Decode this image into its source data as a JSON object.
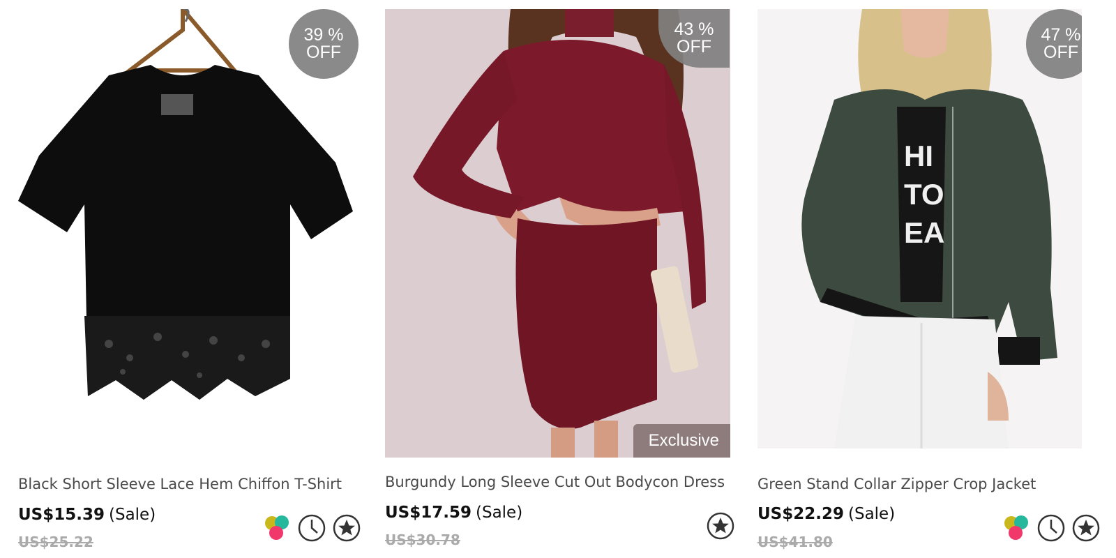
{
  "products": [
    {
      "discount_percent": "39 %",
      "discount_off": "OFF",
      "name": "Black Short Sleeve Lace Hem Chiffon T-Shirt",
      "price": "US$15.39",
      "sale_label": "(Sale)",
      "original_price": "US$25.22",
      "icons": [
        "colors-icon",
        "clock-icon",
        "star-icon"
      ]
    },
    {
      "discount_percent": "43 %",
      "discount_off": "OFF",
      "tag": "Exclusive",
      "name": "Burgundy Long Sleeve Cut Out Bodycon Dress",
      "price": "US$17.59",
      "sale_label": "(Sale)",
      "original_price": "US$30.78",
      "icons": [
        "star-icon"
      ]
    },
    {
      "discount_percent": "47 %",
      "discount_off": "OFF",
      "name": "Green Stand Collar Zipper Crop Jacket",
      "price": "US$22.29",
      "sale_label": "(Sale)",
      "original_price": "US$41.80",
      "icons": [
        "colors-icon",
        "clock-icon",
        "star-icon"
      ]
    }
  ],
  "colors": {
    "badge_bg": "#808080",
    "original_price": "#aaaaaa",
    "name_text": "#4a4a4a",
    "swatch_yellow": "#c9b81b",
    "swatch_teal": "#25b89c",
    "swatch_pink": "#f0386b"
  }
}
